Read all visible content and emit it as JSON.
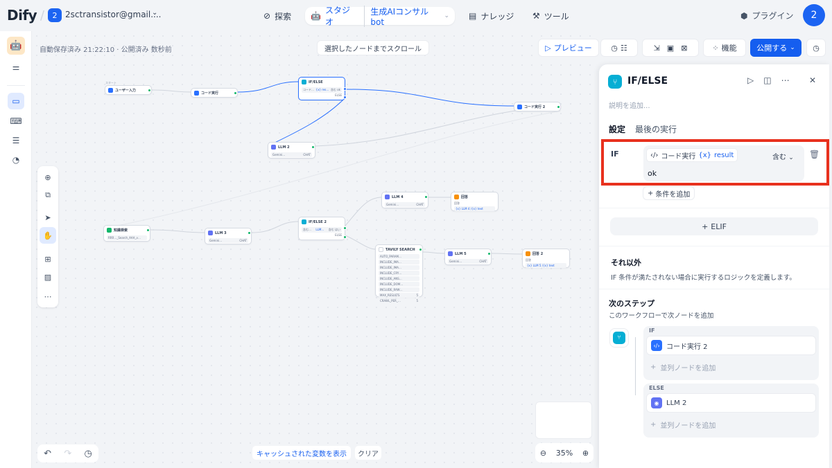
{
  "topbar": {
    "logo": "Dify",
    "workspace_initial": "2",
    "workspace_name": "2sctransistor@gmail....",
    "nav_explore": "探索",
    "nav_studio": "スタジオ",
    "nav_app": "生成AIコンサルbot",
    "nav_knowledge": "ナレッジ",
    "nav_tools": "ツール",
    "plugins": "プラグイン",
    "avatar_initial": "2"
  },
  "canvas": {
    "autosave": "自動保存済み 21:22:10 · 公開済み 数秒前",
    "scroll_to_node": "選択したノードまでスクロール",
    "preview": "プレビュー",
    "features": "機能",
    "publish": "公開する",
    "cache_vars": "キャッシュされた変数を表示",
    "clear": "クリア",
    "zoom": "35%"
  },
  "nodes": {
    "start_tag": "スタート",
    "user_input": "ユーザー入力",
    "code1": "コード実行",
    "ifelse1": "IF/ELSE",
    "ifelse1_row": "コード…",
    "ifelse1_row_val": "{x} res…",
    "ifelse1_row_op": "含む ok",
    "ifelse1_else": "ELSE",
    "code2": "コード実行 2",
    "llm2": "LLM 2",
    "llm_model": "Gemini…",
    "llm_badge": "CHAT",
    "kb": "知識検索",
    "kb_row": "RRR…_Search_AAA_v…",
    "llm3": "LLM 3",
    "ifelse2": "IF/ELSE 2",
    "ifelse2_row": "含む…",
    "ifelse2_row_val": "LLM…",
    "ifelse2_row_op": "含む はい",
    "ifelse2_else": "ELSE",
    "llm4": "LLM 4",
    "ans1": "回答",
    "ans1_label": "回答",
    "ans1_val": "{x} LLM 4 /{x} text",
    "tavily": "TAVILY SEARCH",
    "tavily_rows": [
      "AUTO_PARAM…",
      "INCLUDE_IMA…",
      "INCLUDE_IMA…",
      "INCLUDE_CRY…",
      "INCLUDE_ANS…",
      "INCLUDE_DOM…",
      "INCLUDE_RAW…",
      "MAX_RESULTS",
      "CRAWL_PER_…"
    ],
    "tavily_val1": "5",
    "tavily_val2": "5",
    "llm5": "LLM 5",
    "ans2": "回答 2",
    "ans2_label": "回答",
    "ans2_val": "{x} LLM 5 /{x} text"
  },
  "panel": {
    "title": "IF/ELSE",
    "desc_placeholder": "説明を追加...",
    "tab_settings": "設定",
    "tab_last_run": "最後の実行",
    "if_label": "IF",
    "cond_node": "コード実行",
    "cond_var": "result",
    "cond_op": "含む",
    "cond_value": "ok",
    "add_condition": "条件を追加",
    "elif": "ELIF",
    "else_title": "それ以外",
    "else_desc": "IF 条件が満たされない場合に実行するロジックを定義します。",
    "next_title": "次のステップ",
    "next_desc": "このワークフローで次ノードを追加",
    "branch_if": "IF",
    "branch_if_node": "コード実行 2",
    "branch_else": "ELSE",
    "branch_else_node": "LLM 2",
    "add_parallel": "並列ノードを追加"
  },
  "colors": {
    "accent": "#155eef",
    "ifelse": "#06aed4",
    "llm": "#6172f3",
    "answer": "#f79009",
    "highlight": "#e8311e"
  }
}
